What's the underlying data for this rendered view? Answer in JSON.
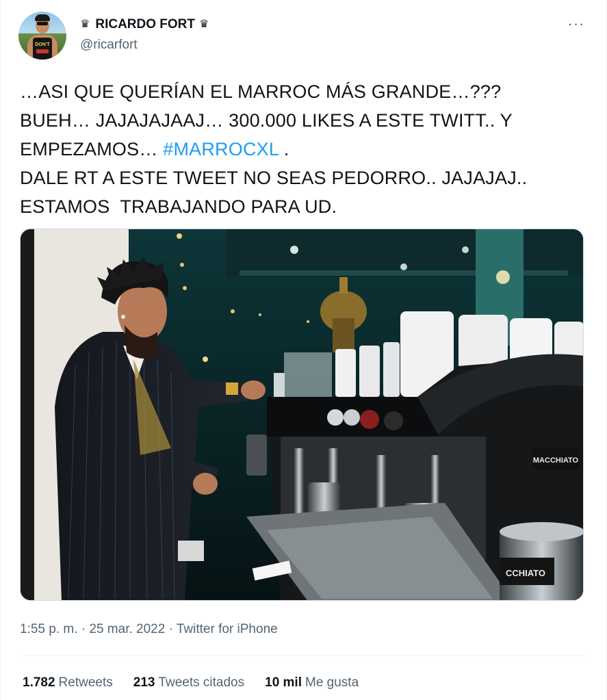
{
  "author": {
    "display_name": "RICARDO FORT",
    "crown_left": "♛",
    "crown_right": "♛",
    "handle": "@ricarfort",
    "avatar_shirt_text": "DON'T"
  },
  "more_menu": {
    "glyph": "···"
  },
  "tweet": {
    "text_before_hashtag": "…ASI QUE QUERÍAN EL MARROC MÁS GRANDE…???\nBUEH… JAJAJAJAAJ… 300.000 LIKES A ESTE TWITT.. Y\nEMPEZAMOS… ",
    "hashtag": "#MARROCXL",
    "text_after_hashtag": " .\nDALE RT A ESTE TWEET NO SEAS PEDORRO.. JAJAJAJ..\nESTAMOS  TRABAJANDO PARA UD."
  },
  "media": {
    "machine_brand": "MACCHIATO",
    "canister_label": "CCHIATO"
  },
  "meta": {
    "time": "1:55 p. m.",
    "separator": " · ",
    "date": "25 mar. 2022",
    "source": "Twitter for iPhone"
  },
  "stats": {
    "retweets_count": "1.782",
    "retweets_label": "Retweets",
    "quotes_count": "213",
    "quotes_label": "Tweets citados",
    "likes_count": "10 mil",
    "likes_label": "Me gusta"
  },
  "colors": {
    "accent": "#1d9bf0",
    "secondary_text": "#536471",
    "primary_text": "#0f1419"
  }
}
